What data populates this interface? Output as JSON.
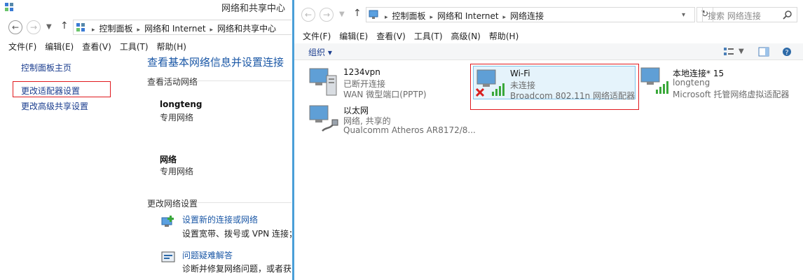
{
  "left": {
    "window_title": "网络和共享中心",
    "breadcrumb": [
      "控制面板",
      "网络和 Internet",
      "网络和共享中心"
    ],
    "menu": [
      "文件(F)",
      "编辑(E)",
      "查看(V)",
      "工具(T)",
      "帮助(H)"
    ],
    "side_links": [
      "控制面板主页",
      "更改适配器设置",
      "更改高级共享设置"
    ],
    "heading": "查看基本网络信息并设置连接",
    "active_label": "查看活动网络",
    "networks": [
      {
        "name": "longteng",
        "type": "专用网络"
      },
      {
        "name": "网络",
        "type": "专用网络"
      }
    ],
    "change_label": "更改网络设置",
    "tasks": [
      {
        "title": "设置新的连接或网络",
        "desc": "设置宽带、拨号或 VPN 连接；或"
      },
      {
        "title": "问题疑难解答",
        "desc": "诊断并修复网络问题，或者获得"
      }
    ]
  },
  "right": {
    "breadcrumb": [
      "控制面板",
      "网络和 Internet",
      "网络连接"
    ],
    "search_placeholder": "搜索 网络连接",
    "menu": [
      "文件(F)",
      "编辑(E)",
      "查看(V)",
      "工具(T)",
      "高级(N)",
      "帮助(H)"
    ],
    "organize": "组织 ▾",
    "connections": [
      {
        "name": "1234vpn",
        "status": "已断开连接",
        "device": "WAN 微型端口(PPTP)"
      },
      {
        "name": "Wi-Fi",
        "status": "未连接",
        "device": "Broadcom 802.11n 网络适配器"
      },
      {
        "name": "本地连接* 15",
        "status": "longteng",
        "device": "Microsoft 托管网络虚拟适配器"
      },
      {
        "name": "以太网",
        "status": "网络, 共享的",
        "device": "Qualcomm Atheros AR8172/8..."
      }
    ]
  },
  "colors": {
    "link": "#1a57a6",
    "highlight": "#e0191e",
    "window_border": "#4a9fd8"
  }
}
